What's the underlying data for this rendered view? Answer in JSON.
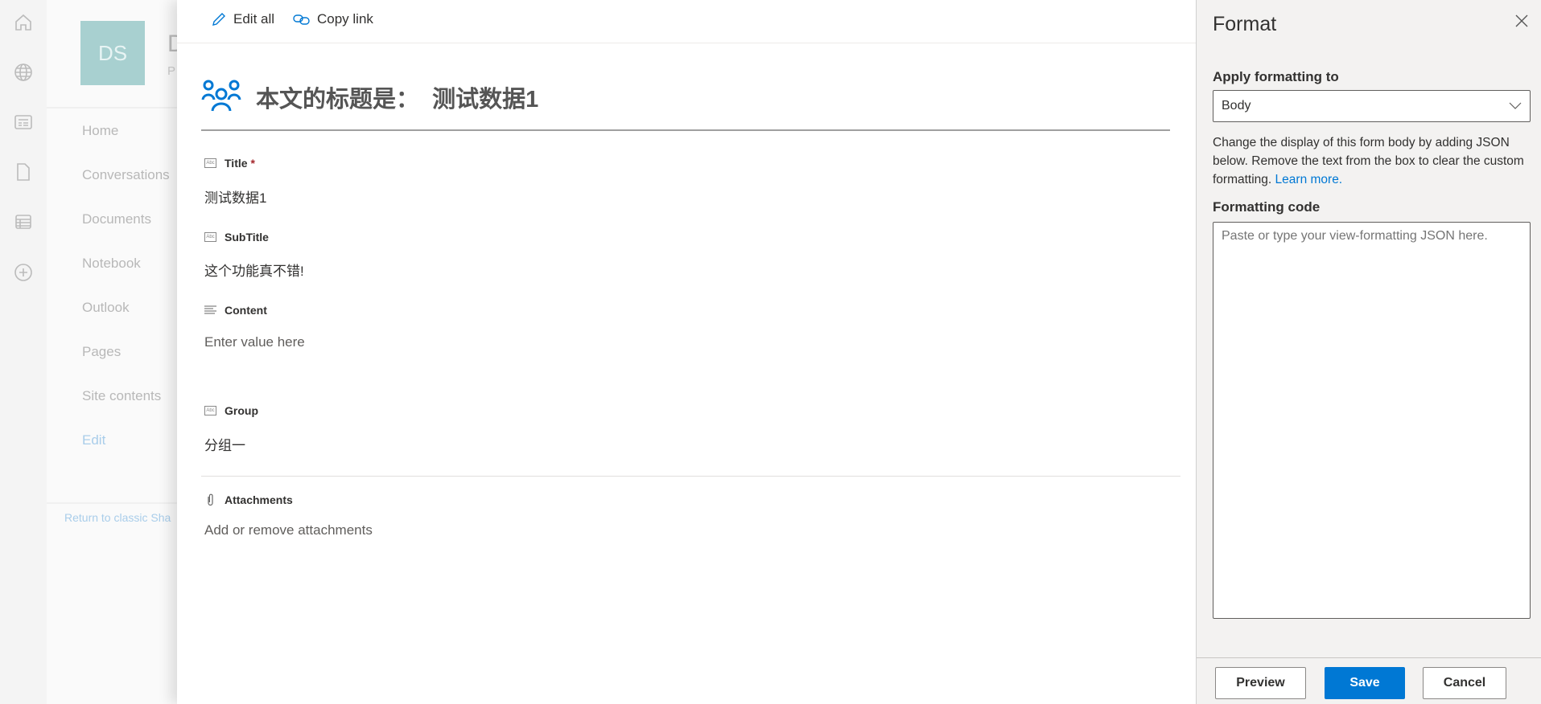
{
  "rail": {
    "icons": [
      "home-icon",
      "globe-icon",
      "news-icon",
      "document-icon",
      "list-icon",
      "add-circle-icon"
    ]
  },
  "site": {
    "logo": "DS",
    "title_partial": "D",
    "subtitle_partial": "P",
    "nav": [
      "Home",
      "Conversations",
      "Documents",
      "Notebook",
      "Outlook",
      "Pages",
      "Site contents",
      "Edit"
    ],
    "return_link": "Return to classic Sha"
  },
  "toolbar": {
    "edit_all": "Edit all",
    "copy_link": "Copy link"
  },
  "form": {
    "header": "本文的标题是：  测试数据1",
    "fields": [
      {
        "label": "Title",
        "required": "*",
        "value": "测试数据1",
        "icon": "Abc"
      },
      {
        "label": "SubTitle",
        "value": "这个功能真不错!",
        "icon": "Abc"
      },
      {
        "label": "Content",
        "placeholder": "Enter value here"
      },
      {
        "label": "Group",
        "value": "分组一",
        "icon": "Abc"
      },
      {
        "label": "Attachments",
        "placeholder": "Add or remove attachments"
      }
    ]
  },
  "format": {
    "title": "Format",
    "apply_label": "Apply formatting to",
    "apply_value": "Body",
    "description": "Change the display of this form body by adding JSON below. Remove the text from the box to clear the custom formatting.",
    "learn_more": "Learn more.",
    "code_label": "Formatting code",
    "code_placeholder": "Paste or type your view-formatting JSON here.",
    "preview": "Preview",
    "save": "Save",
    "cancel": "Cancel"
  },
  "colors": {
    "accent": "#0078d4",
    "logo_bg": "#a8d0d0"
  }
}
